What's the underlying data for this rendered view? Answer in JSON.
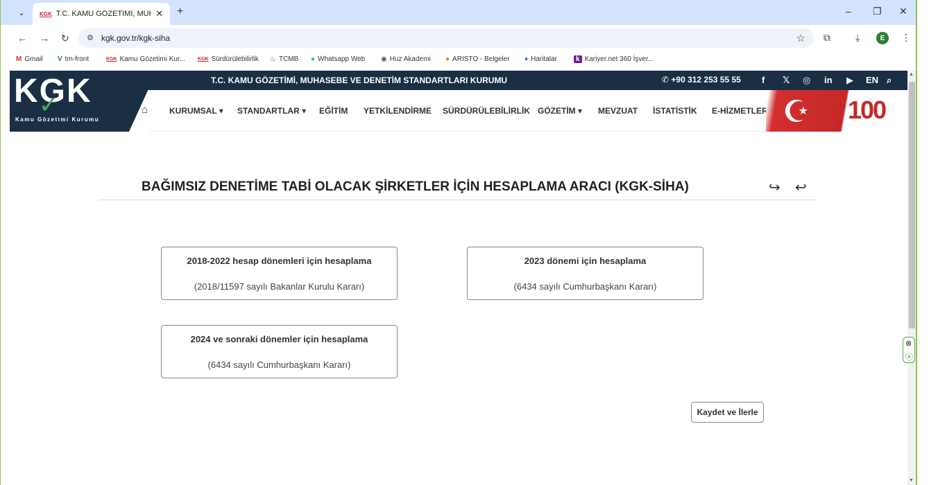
{
  "browser": {
    "tab_title": "T.C. KAMU GÖZETİMİ, MUHASE",
    "tab_favicon": "KGK",
    "url": "kgk.gov.tr/kgk-siha",
    "profile_initial": "E",
    "bookmarks": [
      {
        "label": "Gmail",
        "icon": "M",
        "color": "#d93025"
      },
      {
        "label": "tm-front",
        "icon": "V",
        "color": "#2e7d32"
      },
      {
        "label": "Kamu Gözetimi Kur...",
        "icon": "KGK",
        "color": "#c62828"
      },
      {
        "label": "Sürdürülebilirlik",
        "icon": "KGK",
        "color": "#c62828"
      },
      {
        "label": "TCMB",
        "icon": "♨",
        "color": "#c62828"
      },
      {
        "label": "Whatsapp Web",
        "icon": "●",
        "color": "#25d366"
      },
      {
        "label": "Huz Akademi",
        "icon": "◉",
        "color": "#555555"
      },
      {
        "label": "ARISTO - Belgeler",
        "icon": "●",
        "color": "#f57c00"
      },
      {
        "label": "Haritalar",
        "icon": "♦",
        "color": "#1a73e8"
      },
      {
        "label": "Kariyer.net 360 İşver...",
        "icon": "k",
        "color": "#6a1b9a"
      }
    ]
  },
  "site": {
    "institution": "T.C. KAMU GÖZETİMİ, MUHASEBE VE DENETİM STANDARTLARI KURUMU",
    "phone": "+90 312 253 55 55",
    "lang": "EN",
    "logo_text": "KGK",
    "logo_subtitle": "Kamu Gözetimi Kurumu",
    "centenary": "100",
    "nav": [
      {
        "label": "KURUMSAL",
        "dropdown": "▾"
      },
      {
        "label": "STANDARTLAR",
        "dropdown": "▾"
      },
      {
        "label": "EĞİTİM",
        "dropdown": ""
      },
      {
        "label": "YETKİLENDİRME",
        "dropdown": ""
      },
      {
        "label": "SÜRDÜRÜLEBİLİRLİK",
        "dropdown": ""
      },
      {
        "label": "GÖZETİM",
        "dropdown": "▾"
      },
      {
        "label": "MEVZUAT",
        "dropdown": ""
      },
      {
        "label": "İSTATİSTİK",
        "dropdown": ""
      },
      {
        "label": "E-HİZMETLER",
        "dropdown": ""
      }
    ]
  },
  "main": {
    "title": "BAĞIMSIZ DENETİME TABİ OLACAK ŞİRKETLER İÇİN HESAPLAMA ARACI (KGK-SİHA)",
    "cards": [
      {
        "title": "2018-2022 hesap dönemleri için hesaplama",
        "subtitle": "(2018/11597 sayılı Bakanlar Kurulu Kararı)"
      },
      {
        "title": "2023 dönemi için hesaplama",
        "subtitle": "(6434 sayılı Cumhurbaşkanı Kararı)"
      },
      {
        "title": "2024 ve sonraki dönemler için hesaplama",
        "subtitle": "(6434 sayılı Cumhurbaşkanı Kararı)"
      }
    ],
    "save_label": "Kaydet ve İlerle"
  }
}
